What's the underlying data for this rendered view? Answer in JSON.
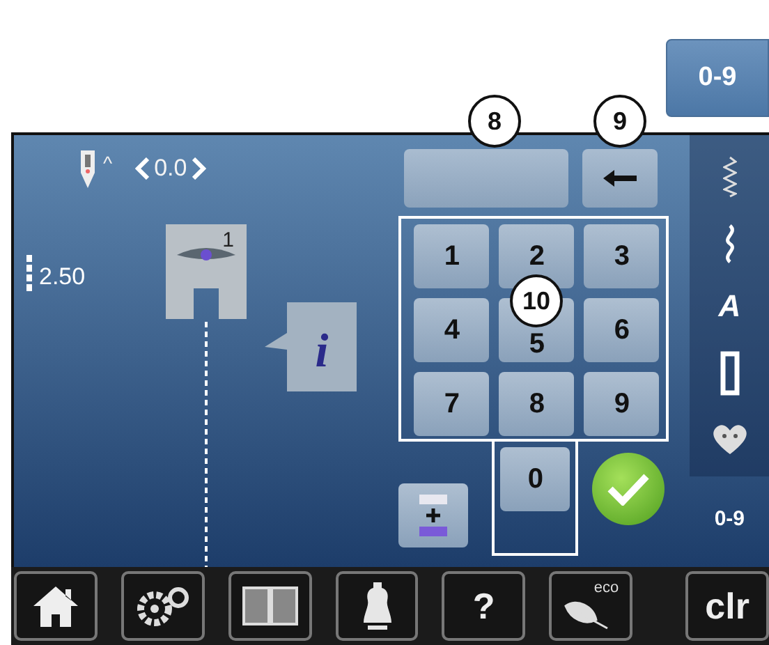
{
  "mode_button": {
    "label": "0-9"
  },
  "callouts": [
    "8",
    "9",
    "10"
  ],
  "needle_position": {
    "indicator": "^",
    "value": "0.0"
  },
  "stitch_length": {
    "value": "2.50"
  },
  "presser_foot": {
    "number": "1"
  },
  "info_button": {
    "label": "i"
  },
  "keypad": {
    "keys": [
      "1",
      "2",
      "3",
      "4",
      "5",
      "6",
      "7",
      "8",
      "9",
      "0"
    ]
  },
  "sidebar": {
    "items": [
      {
        "kind": "stitch"
      },
      {
        "kind": "wave"
      },
      {
        "kind": "alphabet",
        "label": "A"
      },
      {
        "kind": "buttonhole"
      },
      {
        "kind": "heart"
      }
    ],
    "footer": "0-9"
  },
  "bottom_bar": [
    {
      "kind": "home"
    },
    {
      "kind": "settings"
    },
    {
      "kind": "book"
    },
    {
      "kind": "dress-form"
    },
    {
      "kind": "help",
      "label": "?"
    },
    {
      "kind": "eco",
      "label": "eco"
    },
    {
      "kind": "clear",
      "label": "clr"
    }
  ]
}
